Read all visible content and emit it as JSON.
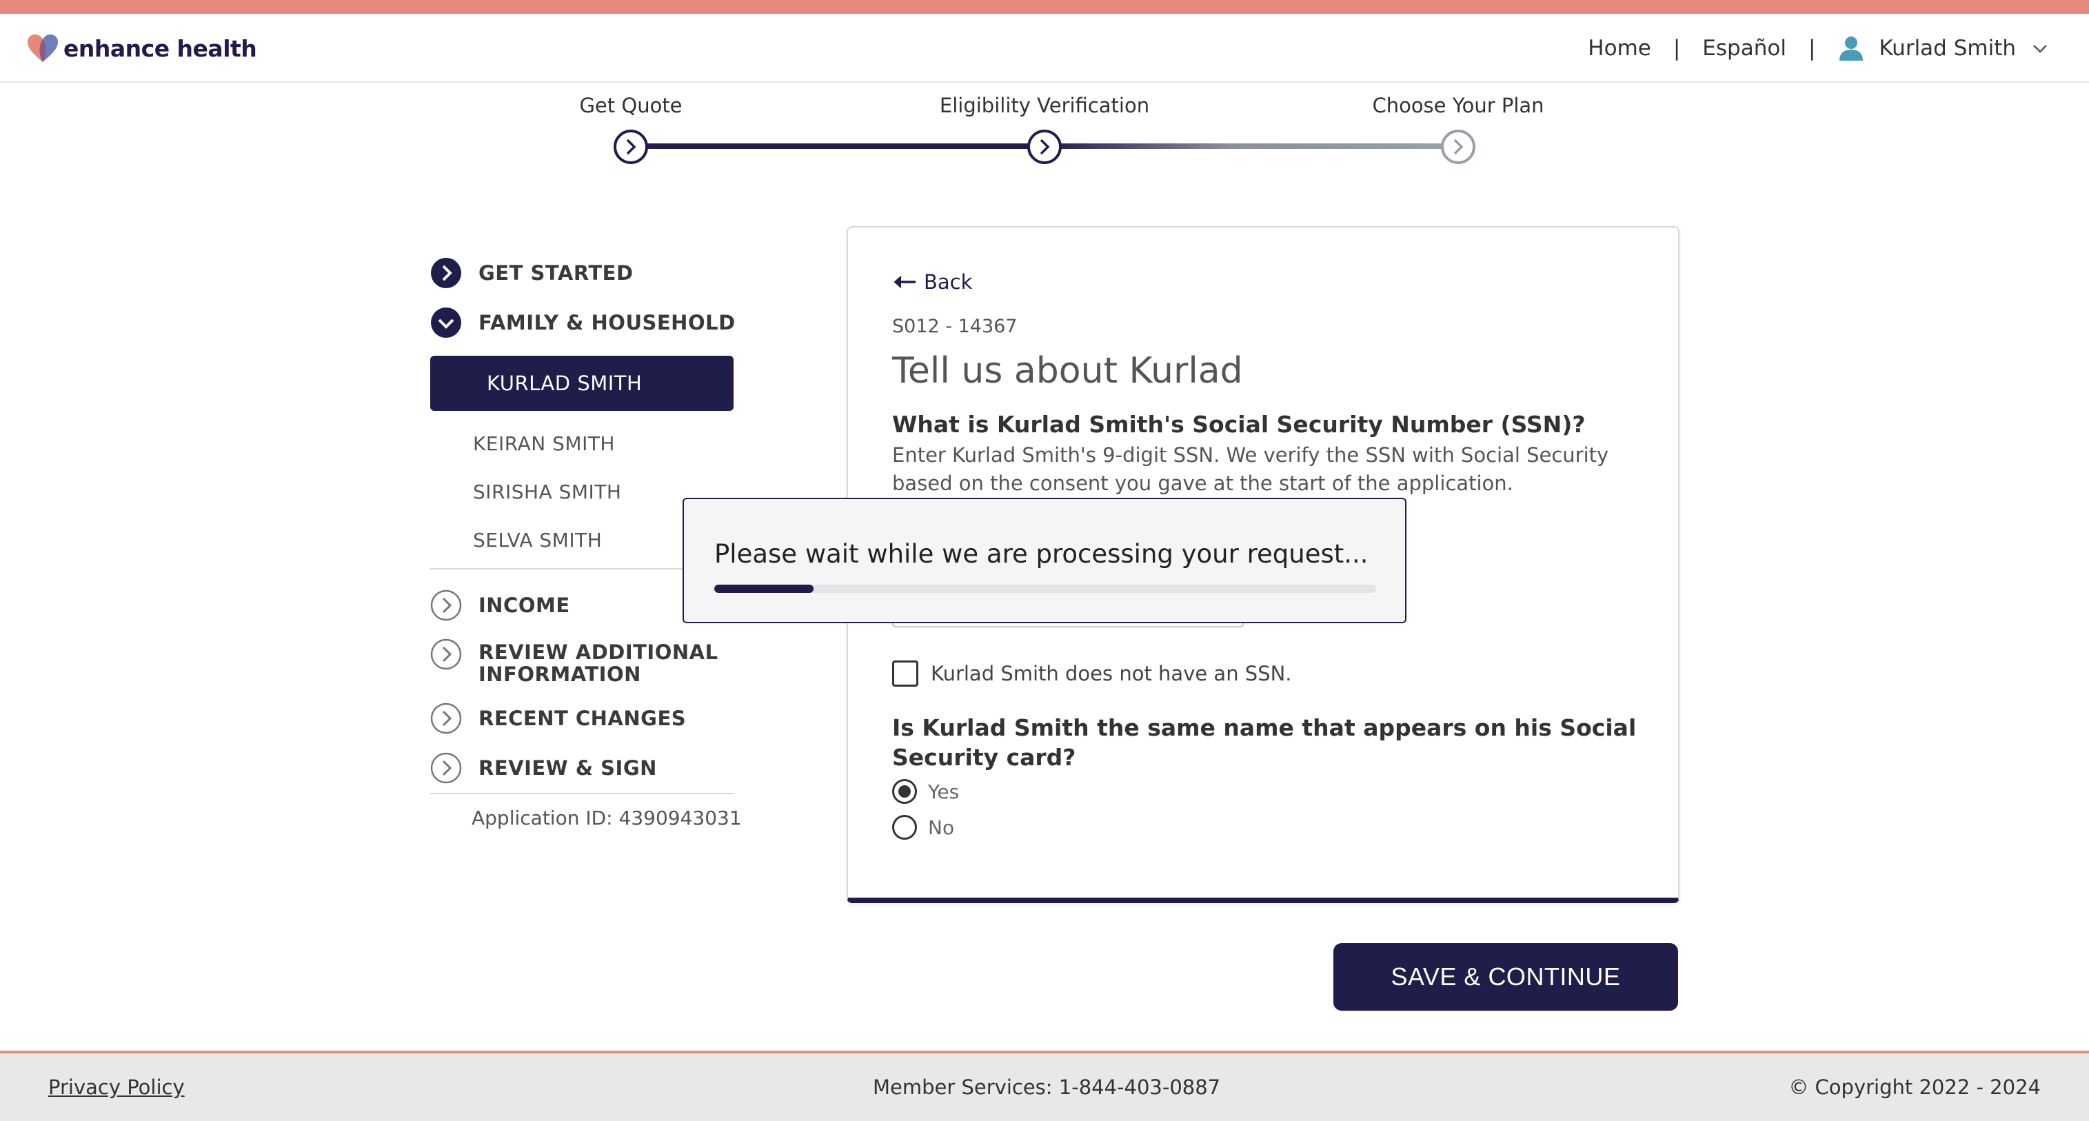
{
  "brand": {
    "name": "enhance health",
    "accent_color": "#e5897a",
    "navy_color": "#1f1d4a"
  },
  "header": {
    "nav": {
      "home": "Home",
      "separator": "|",
      "language": "Español",
      "user_name": "Kurlad Smith"
    }
  },
  "stepper": {
    "steps": [
      {
        "label": "Get Quote",
        "state": "complete"
      },
      {
        "label": "Eligibility Verification",
        "state": "current"
      },
      {
        "label": "Choose Your Plan",
        "state": "upcoming"
      }
    ]
  },
  "sidebar": {
    "sections": [
      {
        "label": "GET STARTED",
        "icon": "chevron-right-filled-icon"
      },
      {
        "label": "FAMILY & HOUSEHOLD",
        "icon": "chevron-down-filled-icon"
      }
    ],
    "members": [
      {
        "label": "KURLAD SMITH",
        "active": true
      },
      {
        "label": "KEIRAN SMITH"
      },
      {
        "label": "SIRISHA SMITH"
      },
      {
        "label": "SELVA SMITH"
      }
    ],
    "later_sections": [
      {
        "label": "INCOME",
        "icon": "chevron-right-outline-icon"
      },
      {
        "label": "REVIEW ADDITIONAL INFORMATION",
        "icon": "chevron-right-outline-icon"
      },
      {
        "label": "RECENT CHANGES",
        "icon": "chevron-right-outline-icon"
      },
      {
        "label": "REVIEW & SIGN",
        "icon": "chevron-right-outline-icon"
      }
    ],
    "application_id": "Application ID: 4390943031"
  },
  "card": {
    "back_label": "Back",
    "code": "S012 - 14367",
    "title": "Tell us about Kurlad",
    "ssn_question": "What is Kurlad Smith's Social Security Number (SSN)?",
    "ssn_help": "Enter Kurlad Smith's 9-digit SSN. We verify the SSN with Social Security based on the consent you gave at the start of the application.",
    "no_ssn_label": "Kurlad Smith does not have an SSN.",
    "no_ssn_checked": false,
    "name_question": "Is Kurlad Smith the same name that appears on his Social Security card?",
    "name_options": [
      {
        "label": "Yes",
        "selected": true
      },
      {
        "label": "No",
        "selected": false
      }
    ]
  },
  "save_button": "SAVE & CONTINUE",
  "modal": {
    "message": "Please wait while we are processing your request...",
    "progress_fraction": 0.15
  },
  "footer": {
    "privacy": "Privacy Policy",
    "member_services": "Member Services: 1-844-403-0887",
    "copyright": "© Copyright 2022 - 2024"
  }
}
